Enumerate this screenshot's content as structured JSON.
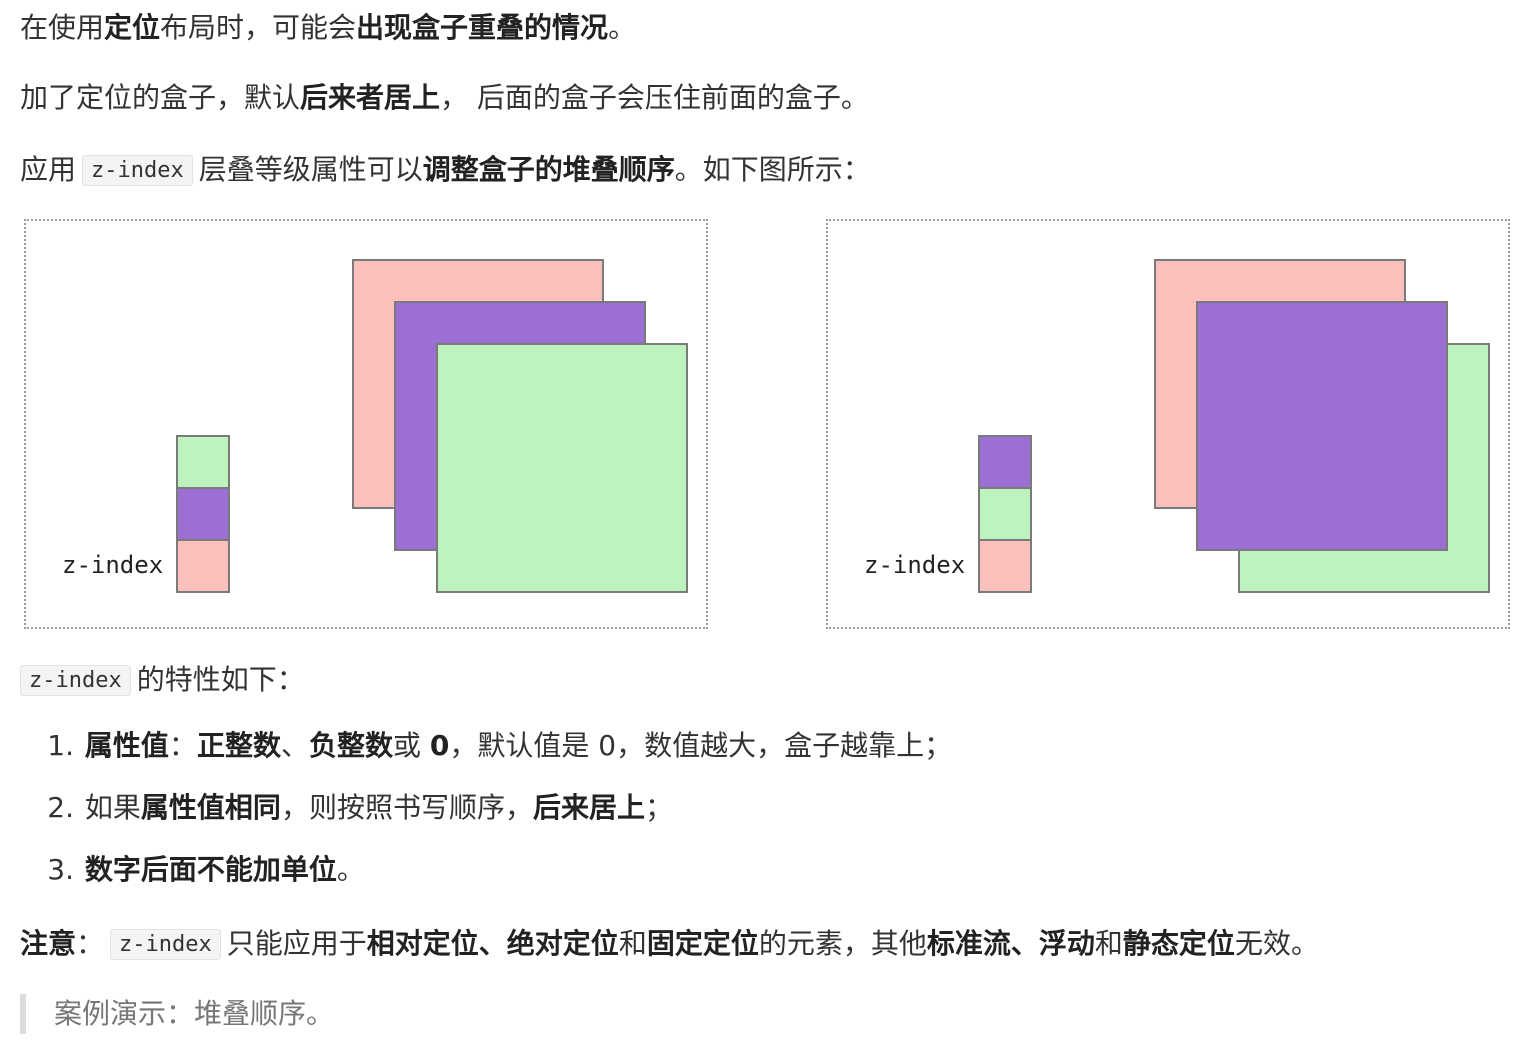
{
  "paragraphs": {
    "p1": {
      "a": "在使用",
      "b": "定位",
      "c": "布局时，可能会",
      "d": "出现盒子重叠的情况",
      "e": "。"
    },
    "p2": {
      "a": "加了定位的盒子，默认",
      "b": "后来者居上",
      "c": "， 后面的盒子会压住前面的盒子。"
    },
    "p3": {
      "a": "应用",
      "code": "z-index",
      "b": "层叠等级属性可以",
      "c": "调整盒子的堆叠顺序",
      "d": "。如下图所示："
    }
  },
  "figures": {
    "left": {
      "label": "z-index"
    },
    "right": {
      "label": "z-index"
    }
  },
  "properties": {
    "heading_code": "z-index",
    "heading_text": "的特性如下：",
    "items": [
      {
        "num": "1.",
        "parts": [
          "属性值",
          "：",
          "正整数",
          "、",
          "负整数",
          "或 ",
          "0",
          "，默认值是 0，数值越大，盒子越靠上；"
        ]
      },
      {
        "num": "2.",
        "parts": [
          "如果",
          "属性值相同",
          "，则按照书写顺序，",
          "后来居上",
          "；"
        ]
      },
      {
        "num": "3.",
        "parts": [
          "数字后面不能加单位",
          "。"
        ]
      }
    ]
  },
  "note": {
    "label": "注意",
    "colon": "：",
    "code": "z-index",
    "a": "只能应用于",
    "b": "相对定位",
    "c": "、",
    "d": "绝对定位",
    "e": "和",
    "f": "固定定位",
    "g": "的元素，其他",
    "h": "标准流",
    "i": "、",
    "j": "浮动",
    "k": "和",
    "l": "静态定位",
    "m": "无效。"
  },
  "quote": {
    "text": "案例演示：堆叠顺序。"
  },
  "colors": {
    "pink": "#fbbfbc",
    "purple": "#9b6fd4",
    "green": "#bdf3bd",
    "dotted_border": "#9a9a9a"
  }
}
